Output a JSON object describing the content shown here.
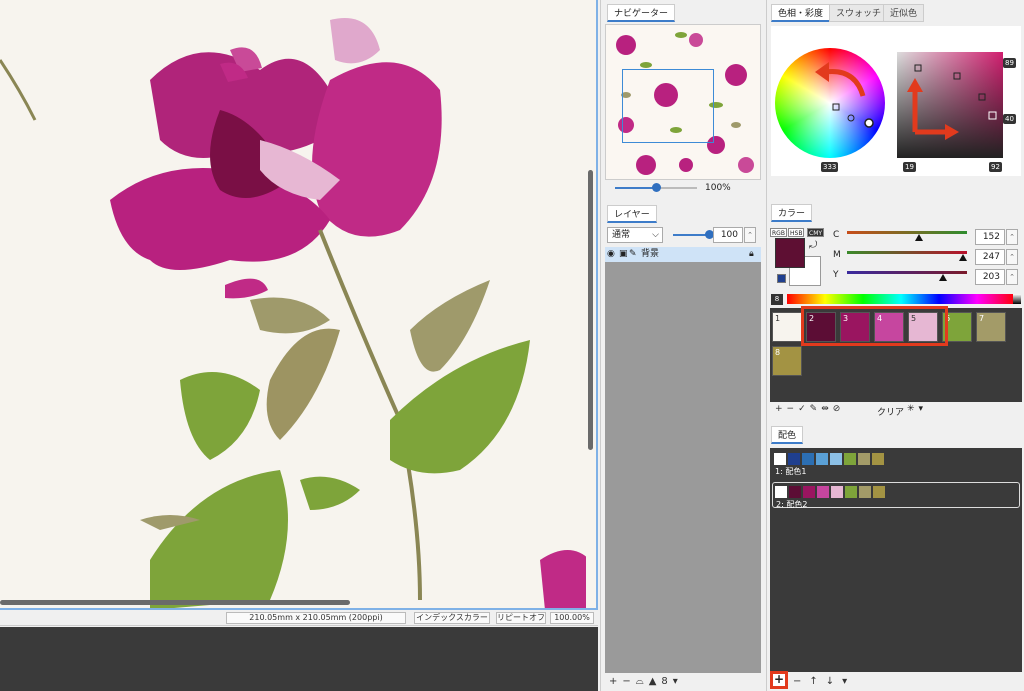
{
  "canvas": {
    "status_size": "210.05mm x 210.05mm (200ppi)",
    "status_index_color": "インデックスカラー",
    "status_repeat": "リピートオフ",
    "status_zoom": "100.00%"
  },
  "navigator": {
    "tab": "ナビゲーター",
    "zoom": "100%",
    "zoom_fraction": 0.5
  },
  "layers": {
    "tab": "レイヤー",
    "blend_mode": "通常",
    "opacity": "100",
    "opacity_fraction": 1.0,
    "items": [
      {
        "name": "背景"
      }
    ]
  },
  "color_panel": {
    "tabs": [
      "色相・彩度",
      "スウォッチ",
      "近似色"
    ],
    "wheel_value": "333",
    "square_top_right": "89",
    "square_right_mid": "40",
    "square_bottom_left": "19",
    "square_bottom_right": "92"
  },
  "color_section": {
    "tab": "カラー",
    "modes": [
      "RGB",
      "HSB",
      "CMY"
    ],
    "active_mode": "CMY",
    "foreground": "#5e0f33",
    "background": "#ffffff",
    "channels": [
      {
        "label": "C",
        "value": "152",
        "fraction": 0.6,
        "gradient": [
          "#c84d1a",
          "#2e8c2e"
        ]
      },
      {
        "label": "M",
        "value": "247",
        "fraction": 0.97,
        "gradient": [
          "#3a8a2a",
          "#b8102c"
        ]
      },
      {
        "label": "Y",
        "value": "203",
        "fraction": 0.8,
        "gradient": [
          "#3a2a9e",
          "#7a1a2a"
        ]
      }
    ],
    "index_number": "8"
  },
  "swatches": [
    {
      "num": "1",
      "color": "#f7f4ee",
      "dark": true
    },
    {
      "num": "2",
      "color": "#5c0d35",
      "dark": false
    },
    {
      "num": "3",
      "color": "#9a1560",
      "dark": false
    },
    {
      "num": "4",
      "color": "#c6469f",
      "dark": false
    },
    {
      "num": "5",
      "color": "#e6b7d3",
      "dark": true
    },
    {
      "num": "6",
      "color": "#7ea43a",
      "dark": false
    },
    {
      "num": "7",
      "color": "#a39b68",
      "dark": false
    },
    {
      "num": "8",
      "color": "#a39343",
      "dark": false
    }
  ],
  "swatch_toolbar": {
    "clear_label": "クリア"
  },
  "palettes": {
    "tab": "配色",
    "items": [
      {
        "label": "1: 配色1",
        "colors": [
          "#ffffff",
          "#1f3f8f",
          "#2c6fb3",
          "#5aa0d6",
          "#8cc0e6",
          "#7ea43a",
          "#a39b68",
          "#a39343"
        ]
      },
      {
        "label": "2: 配色2",
        "colors": [
          "#ffffff",
          "#5c0d35",
          "#9a1560",
          "#c6469f",
          "#e6b7d3",
          "#7ea43a",
          "#a39b68",
          "#a39343"
        ]
      }
    ]
  }
}
